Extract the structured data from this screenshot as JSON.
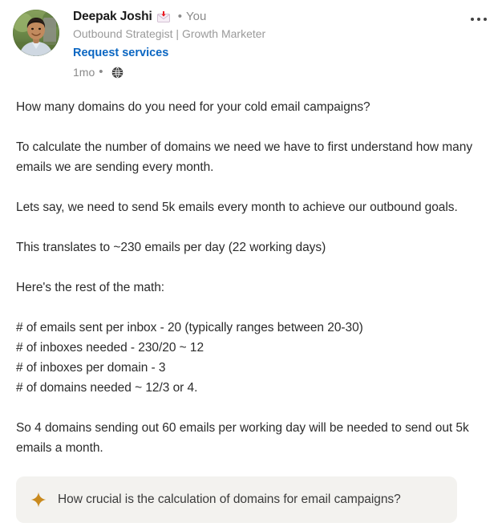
{
  "post": {
    "author": {
      "name": "Deepak Joshi",
      "name_emoji": "incoming-envelope",
      "separator": "•",
      "relationship": "You",
      "headline": "Outbound Strategist | Growth Marketer",
      "request_services_label": "Request services",
      "avatar_alt": "avatar-photo"
    },
    "meta": {
      "timestamp": "1mo",
      "separator": "•",
      "visibility_icon": "globe-icon"
    },
    "more_menu_icon": "ellipsis-horizontal-icon",
    "content": {
      "paragraphs": [
        "How many domains do you need for your cold email campaigns?",
        "To calculate the number of domains we need we have to first understand how many emails we are sending every month.",
        "Lets say, we need to send 5k emails every month to achieve our outbound goals.",
        "This translates to ~230 emails per day (22 working days)",
        "Here's the rest of the math:"
      ],
      "math_lines": [
        "# of emails sent per inbox - 20 (typically ranges between 20-30)",
        "# of inboxes needed - 230/20 ~ 12",
        "# of inboxes per domain - 3",
        "# of domains needed ~ 12/3 or 4."
      ],
      "closing_paragraph": "So 4 domains sending out 60 emails per working day will be needed to send out 5k emails a month."
    },
    "suggestion": {
      "icon": "sparkle-icon",
      "text": "How crucial is the calculation of domains for email campaigns?",
      "background_color": "#f3f2ef",
      "icon_color": "#c98a1e"
    }
  },
  "colors": {
    "link_blue": "#0a66c2",
    "text_primary": "#2b2b2b",
    "text_muted": "#8a8a8a",
    "sparkle_gold": "#c98a1e",
    "chip_bg": "#f3f2ef"
  }
}
